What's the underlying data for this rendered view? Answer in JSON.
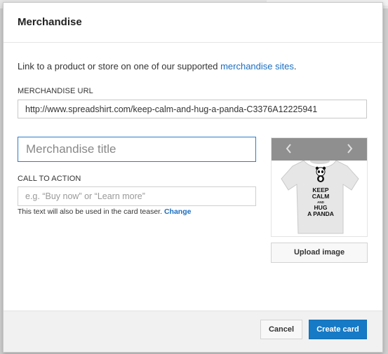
{
  "dialog": {
    "title": "Merchandise",
    "intro_text": "Link to a product or store on one of our supported ",
    "intro_link": "merchandise sites",
    "intro_end": "."
  },
  "form": {
    "url_label": "MERCHANDISE URL",
    "url_value": "http://www.spreadshirt.com/keep-calm-and-hug-a-panda-C3376A12225941",
    "title_placeholder": "Merchandise title",
    "cta_label": "CALL TO ACTION",
    "cta_placeholder": "e.g. “Buy now” or “Learn more”",
    "hint_text": "This text will also be used in the card teaser. ",
    "hint_link": "Change"
  },
  "preview": {
    "prev_icon": "chevron-left-icon",
    "next_icon": "chevron-right-icon",
    "shirt_lines": [
      "KEEP",
      "CALM",
      "AND",
      "HUG",
      "A PANDA"
    ],
    "upload_label": "Upload image"
  },
  "footer": {
    "cancel_label": "Cancel",
    "create_label": "Create card"
  },
  "colors": {
    "accent": "#167ac6",
    "link": "#1a6ec1",
    "focus_border": "#2f7bc8"
  }
}
